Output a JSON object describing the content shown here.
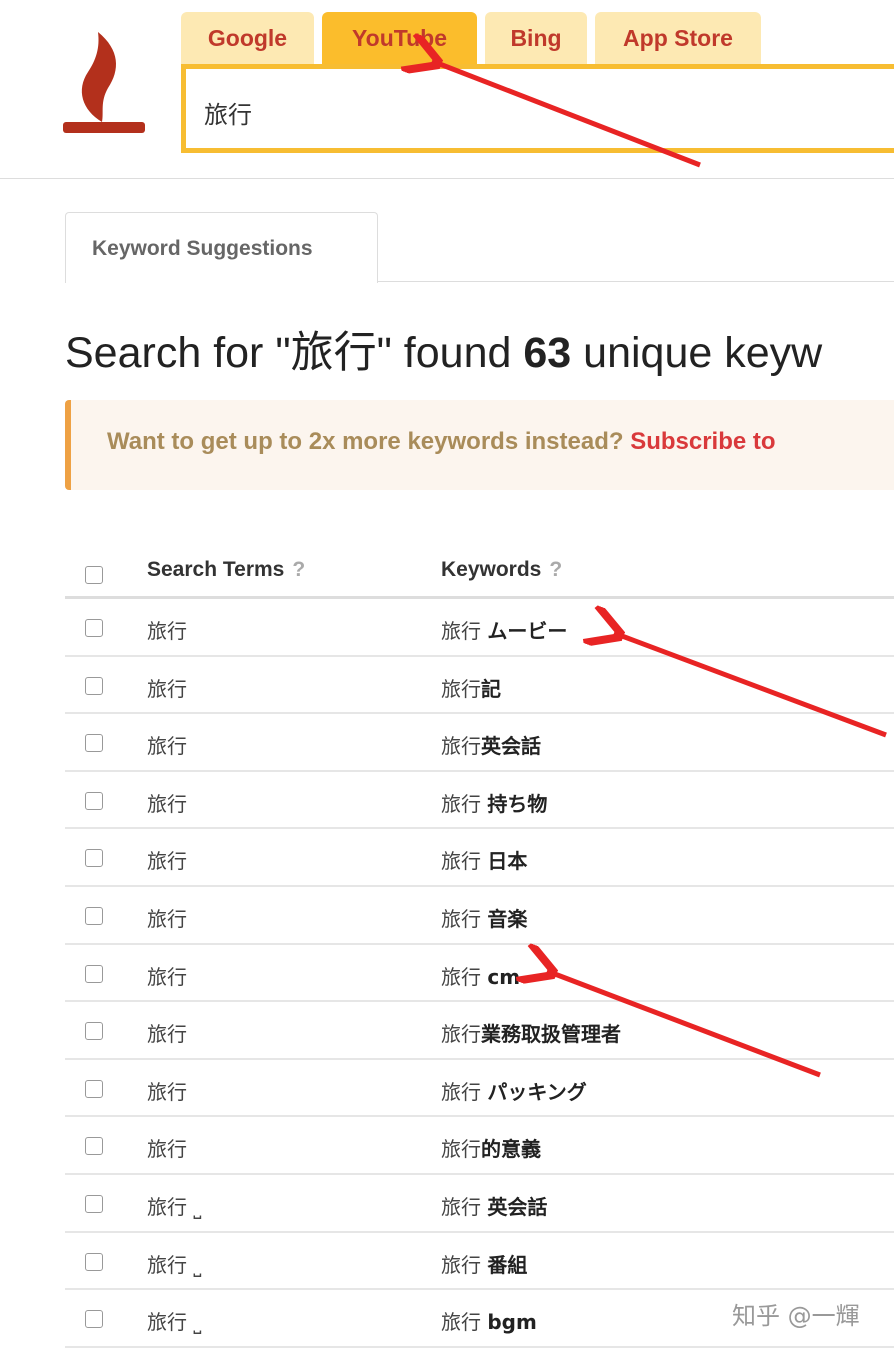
{
  "engine_tabs": [
    {
      "label": "Google",
      "active": false
    },
    {
      "label": "YouTube",
      "active": true
    },
    {
      "label": "Bing",
      "active": false
    },
    {
      "label": "App Store",
      "active": false
    }
  ],
  "search": {
    "value": "旅行"
  },
  "results_tab": {
    "label": "Keyword Suggestions"
  },
  "heading": {
    "prefix": "Search for \"旅行\" found ",
    "count": "63",
    "suffix": " unique keyw"
  },
  "alert": {
    "text": "Want to get up to 2x more keywords instead? ",
    "link": "Subscribe to"
  },
  "table": {
    "headers": {
      "search_terms": "Search Terms",
      "keywords": "Keywords",
      "help": "?"
    },
    "rows": [
      {
        "term": "旅行",
        "kw_prefix": "旅行 ",
        "kw_bold": "ムービー"
      },
      {
        "term": "旅行",
        "kw_prefix": "旅行",
        "kw_bold": "記"
      },
      {
        "term": "旅行",
        "kw_prefix": "旅行",
        "kw_bold": "英会話"
      },
      {
        "term": "旅行",
        "kw_prefix": "旅行 ",
        "kw_bold": "持ち物"
      },
      {
        "term": "旅行",
        "kw_prefix": "旅行 ",
        "kw_bold": "日本"
      },
      {
        "term": "旅行",
        "kw_prefix": "旅行 ",
        "kw_bold": "音楽"
      },
      {
        "term": "旅行",
        "kw_prefix": "旅行 ",
        "kw_bold": "cm"
      },
      {
        "term": "旅行",
        "kw_prefix": "旅行",
        "kw_bold": "業務取扱管理者"
      },
      {
        "term": "旅行",
        "kw_prefix": "旅行 ",
        "kw_bold": "パッキング"
      },
      {
        "term": "旅行",
        "kw_prefix": "旅行",
        "kw_bold": "的意義"
      },
      {
        "term": "旅行 ⎵",
        "kw_prefix": "旅行 ",
        "kw_bold": "英会話"
      },
      {
        "term": "旅行 ⎵",
        "kw_prefix": "旅行 ",
        "kw_bold": "番組"
      },
      {
        "term": "旅行 ⎵",
        "kw_prefix": "旅行 ",
        "kw_bold": "bgm"
      }
    ]
  },
  "watermark": "知乎 @一輝",
  "colors": {
    "brand": "#b3301c",
    "tab_inactive": "#fde9b3",
    "tab_active": "#fbbd2c",
    "annotation_arrow": "#e82424",
    "link": "#d9393b"
  }
}
